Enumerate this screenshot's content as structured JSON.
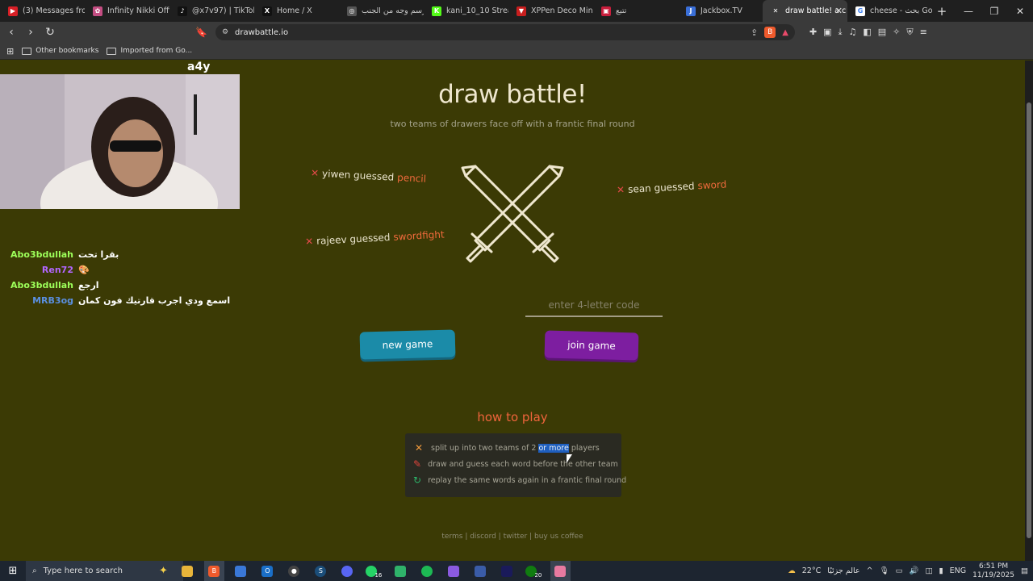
{
  "browser": {
    "tabs": [
      {
        "title": "(3) Messages from",
        "color": "#d81f26",
        "glyph": "▶"
      },
      {
        "title": "Infinity Nikki Officia",
        "color": "#c44d82",
        "glyph": "✿"
      },
      {
        "title": "@x7v97) | TikTok(7)",
        "color": "#111111",
        "glyph": "♪"
      },
      {
        "title": "Home / X",
        "color": "#111111",
        "glyph": "X"
      },
      {
        "title": "رسم وجه من الجنب",
        "color": "#555555",
        "glyph": "◎"
      },
      {
        "title": "kani_10_10 Stream",
        "color": "#53fc18",
        "glyph": "K"
      },
      {
        "title": "XPPen Deco Mini7 V",
        "color": "#c81e1e",
        "glyph": "▼"
      },
      {
        "title": "تتبع",
        "color": "#c81e3c",
        "glyph": "▣"
      },
      {
        "title": "Jackbox.TV",
        "color": "#3a6fd8",
        "glyph": "J"
      },
      {
        "title": "draw battle! a c",
        "color": "#3a3a3a",
        "glyph": "✕"
      },
      {
        "title": "cheese - بحث Goog",
        "color": "#ffffff",
        "glyph": "G"
      }
    ],
    "url": "drawbattle.io",
    "bookmarks": [
      "Other bookmarks",
      "Imported from Go..."
    ]
  },
  "overlay": {
    "tag": "a4y",
    "chat": [
      {
        "nick": "Abo3bdullah",
        "color": "#9dff5a",
        "msg": "بقرا تحت"
      },
      {
        "nick": "Ren72",
        "color": "#b266ff",
        "msg": "🎨"
      },
      {
        "nick": "Abo3bdullah",
        "color": "#9dff5a",
        "msg": "ارجع"
      },
      {
        "nick": "MRB3og",
        "color": "#5a8fe0",
        "msg": "اسمع ودي اجرب قارتيك فون كمان"
      }
    ]
  },
  "page": {
    "title": "draw battle!",
    "subtitle": "two teams of drawers face off with a frantic final round",
    "guesses": [
      {
        "name": "yiwen guessed",
        "word": "pencil"
      },
      {
        "name": "sean guessed",
        "word": "sword"
      },
      {
        "name": "rajeev guessed",
        "word": "swordfight"
      }
    ],
    "code_placeholder": "enter 4-letter code",
    "new_game": "new game",
    "join_game": "join game",
    "howto_title": "how to play",
    "howto": {
      "step1_pre": "split up into two teams of 2 ",
      "step1_sel": "or more",
      "step1_post": " players",
      "step2": "draw and guess each word before the other team",
      "step3": "replay the same words again in a frantic final round"
    },
    "footer": "terms | discord | twitter | buy us coffee"
  },
  "taskbar": {
    "search_placeholder": "Type here to search",
    "badge_whatsapp": "16",
    "badge_xbox": "20",
    "weather": "22°C",
    "weather_text": "عالم جزئيًا",
    "lang": "ENG",
    "time": "6:51 PM",
    "date": "11/19/2025"
  }
}
